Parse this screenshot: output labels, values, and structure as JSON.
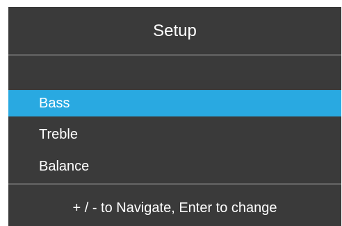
{
  "header": {
    "title": "Setup"
  },
  "menu": {
    "selected_index": 0,
    "items": [
      {
        "label": "Bass"
      },
      {
        "label": "Treble"
      },
      {
        "label": "Balance"
      }
    ]
  },
  "footer": {
    "hint": "+ / - to Navigate, Enter to change"
  },
  "colors": {
    "panel_background": "#3a3a3a",
    "selection_highlight": "#29a9e1",
    "divider": "#5c5c5c",
    "text": "#ffffff"
  }
}
